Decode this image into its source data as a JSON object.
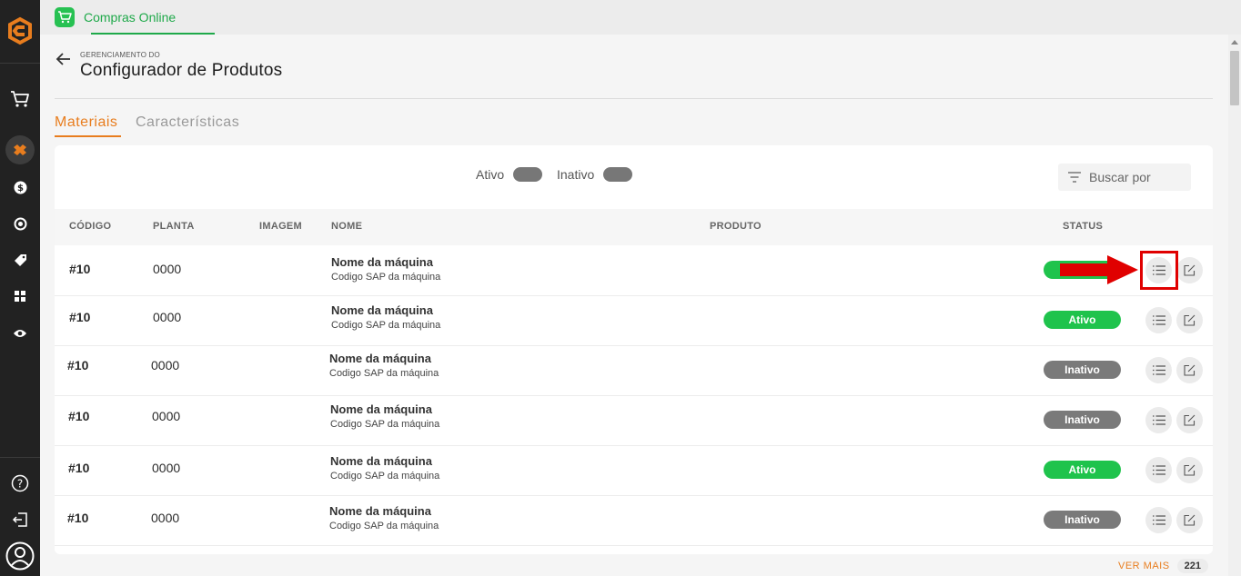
{
  "app_tab": {
    "label": "Compras Online"
  },
  "header": {
    "overline": "GERENCIAMENTO DO",
    "title": "Configurador de Produtos"
  },
  "tabs": [
    {
      "label": "Materiais",
      "active": true
    },
    {
      "label": "Características",
      "active": false
    }
  ],
  "filters": {
    "active_label": "Ativo",
    "inactive_label": "Inativo"
  },
  "search": {
    "placeholder": "Buscar por"
  },
  "table": {
    "columns": [
      "CÓDIGO",
      "PLANTA",
      "IMAGEM",
      "NOME",
      "PRODUTO",
      "STATUS"
    ],
    "rows": [
      {
        "code": "#10",
        "plant": "0000",
        "name": "Nome da máquina",
        "sap": "Codigo SAP da máquina",
        "status": "",
        "status_type": "active"
      },
      {
        "code": "#10",
        "plant": "0000",
        "name": "Nome da máquina",
        "sap": "Codigo SAP da máquina",
        "status": "Ativo",
        "status_type": "active"
      },
      {
        "code": "#10",
        "plant": "0000",
        "name": "Nome da máquina",
        "sap": "Codigo SAP da máquina",
        "status": "Inativo",
        "status_type": "inactive"
      },
      {
        "code": "#10",
        "plant": "0000",
        "name": "Nome da máquina",
        "sap": "Codigo SAP da máquina",
        "status": "Inativo",
        "status_type": "inactive"
      },
      {
        "code": "#10",
        "plant": "0000",
        "name": "Nome da máquina",
        "sap": "Codigo SAP da máquina",
        "status": "Ativo",
        "status_type": "active"
      },
      {
        "code": "#10",
        "plant": "0000",
        "name": "Nome da máquina",
        "sap": "Codigo SAP da máquina",
        "status": "Inativo",
        "status_type": "inactive"
      }
    ]
  },
  "footer": {
    "see_more": "VER MAIS",
    "count": "221"
  },
  "colors": {
    "accent": "#e87d1e",
    "active": "#1fc34c",
    "inactive": "#7a7a7a",
    "sidebar": "#222222",
    "highlight": "#e00000"
  },
  "sidebar_icons": [
    "logo-icon",
    "cart-icon",
    "tools-icon",
    "dollar-icon",
    "exchange-icon",
    "tag-icon",
    "grid-icon",
    "eye-icon",
    "help-icon",
    "logout-icon",
    "user-icon"
  ]
}
